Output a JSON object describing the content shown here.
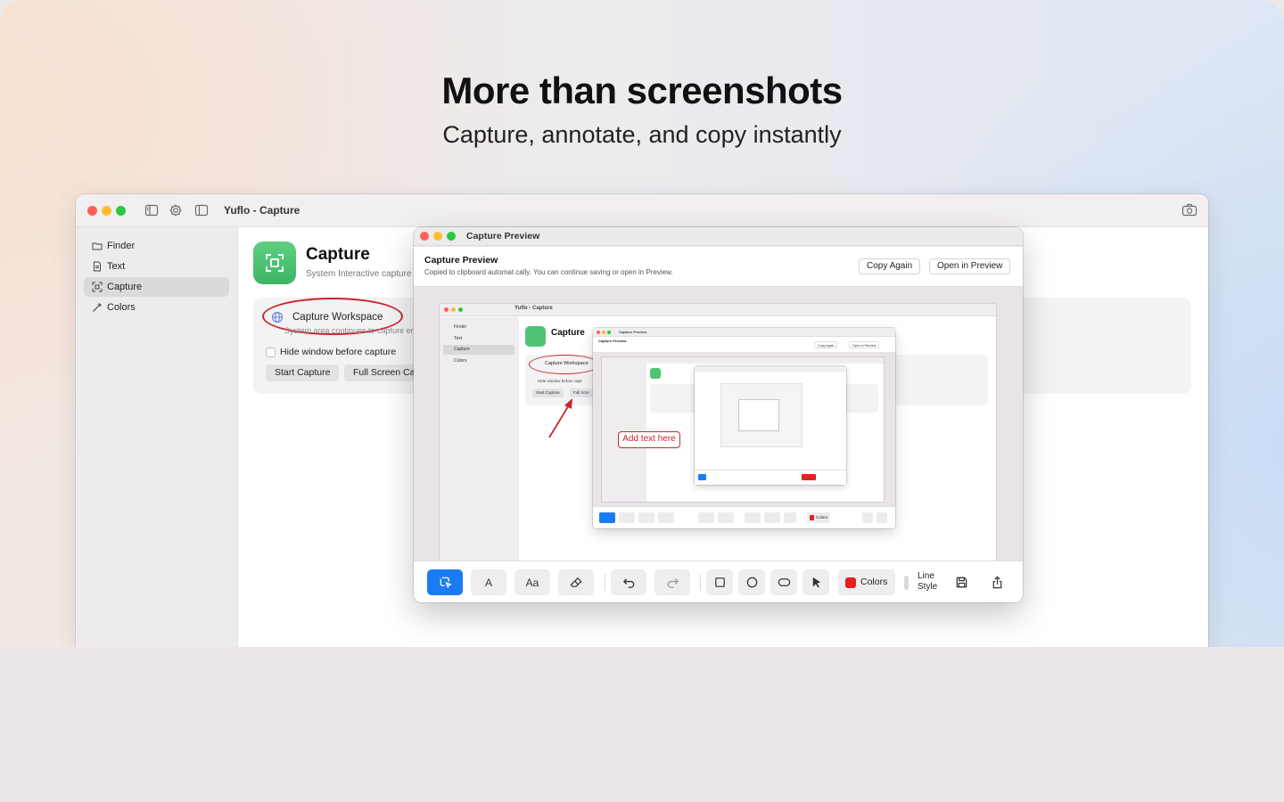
{
  "hero": {
    "headline": "More than screenshots",
    "subheadline": "Capture, annotate, and copy instantly"
  },
  "app": {
    "title": "Yuflo - Capture",
    "sidebar": [
      {
        "label": "Finder",
        "icon": "folder-icon"
      },
      {
        "label": "Text",
        "icon": "document-icon"
      },
      {
        "label": "Capture",
        "icon": "capture-icon",
        "active": true
      },
      {
        "label": "Colors",
        "icon": "eyedropper-icon"
      }
    ],
    "capture": {
      "title": "Capture",
      "subtitle": "System Interactive capture",
      "workspace_label": "Capture Workspace",
      "workspace_sub": "System area continues to capture en",
      "hide_window_label": "Hide window before capture",
      "start_button": "Start Capture",
      "fullscreen_button": "Full Screen Cap"
    }
  },
  "preview": {
    "window_title": "Capture Preview",
    "header_title": "Capture Preview",
    "header_sub": "Copied to clipboard automat cally. You can continue saving or open in Preview.",
    "copy_again": "Copy Again",
    "open_in_preview": "Open in Preview",
    "annotation_text": "Add text here",
    "toolbar": {
      "text_tool": "A",
      "font_tool": "Aa",
      "colors_label": "Colors",
      "line_style_label_1": "Line",
      "line_style_label_2": "Style",
      "color_swatch": "#e8201f"
    }
  },
  "nested": {
    "app_title": "Yuflo - Capture",
    "sidebar": [
      "Finder",
      "Text",
      "Capture",
      "Colors"
    ],
    "capture_title": "Capture",
    "workspace_label": "Capture Workspace",
    "hide_label": "Hide window before capt",
    "start_btn": "Start Capture",
    "full_btn": "Full Scre",
    "preview_title": "Capture Preview",
    "copy_again": "Copy Again",
    "open_in_preview": "Open in Preview",
    "colors": "Colors"
  },
  "colors": {
    "accent_blue": "#1a7cf5",
    "capture_green": "#3db564",
    "annotation_red": "#c8262b"
  }
}
